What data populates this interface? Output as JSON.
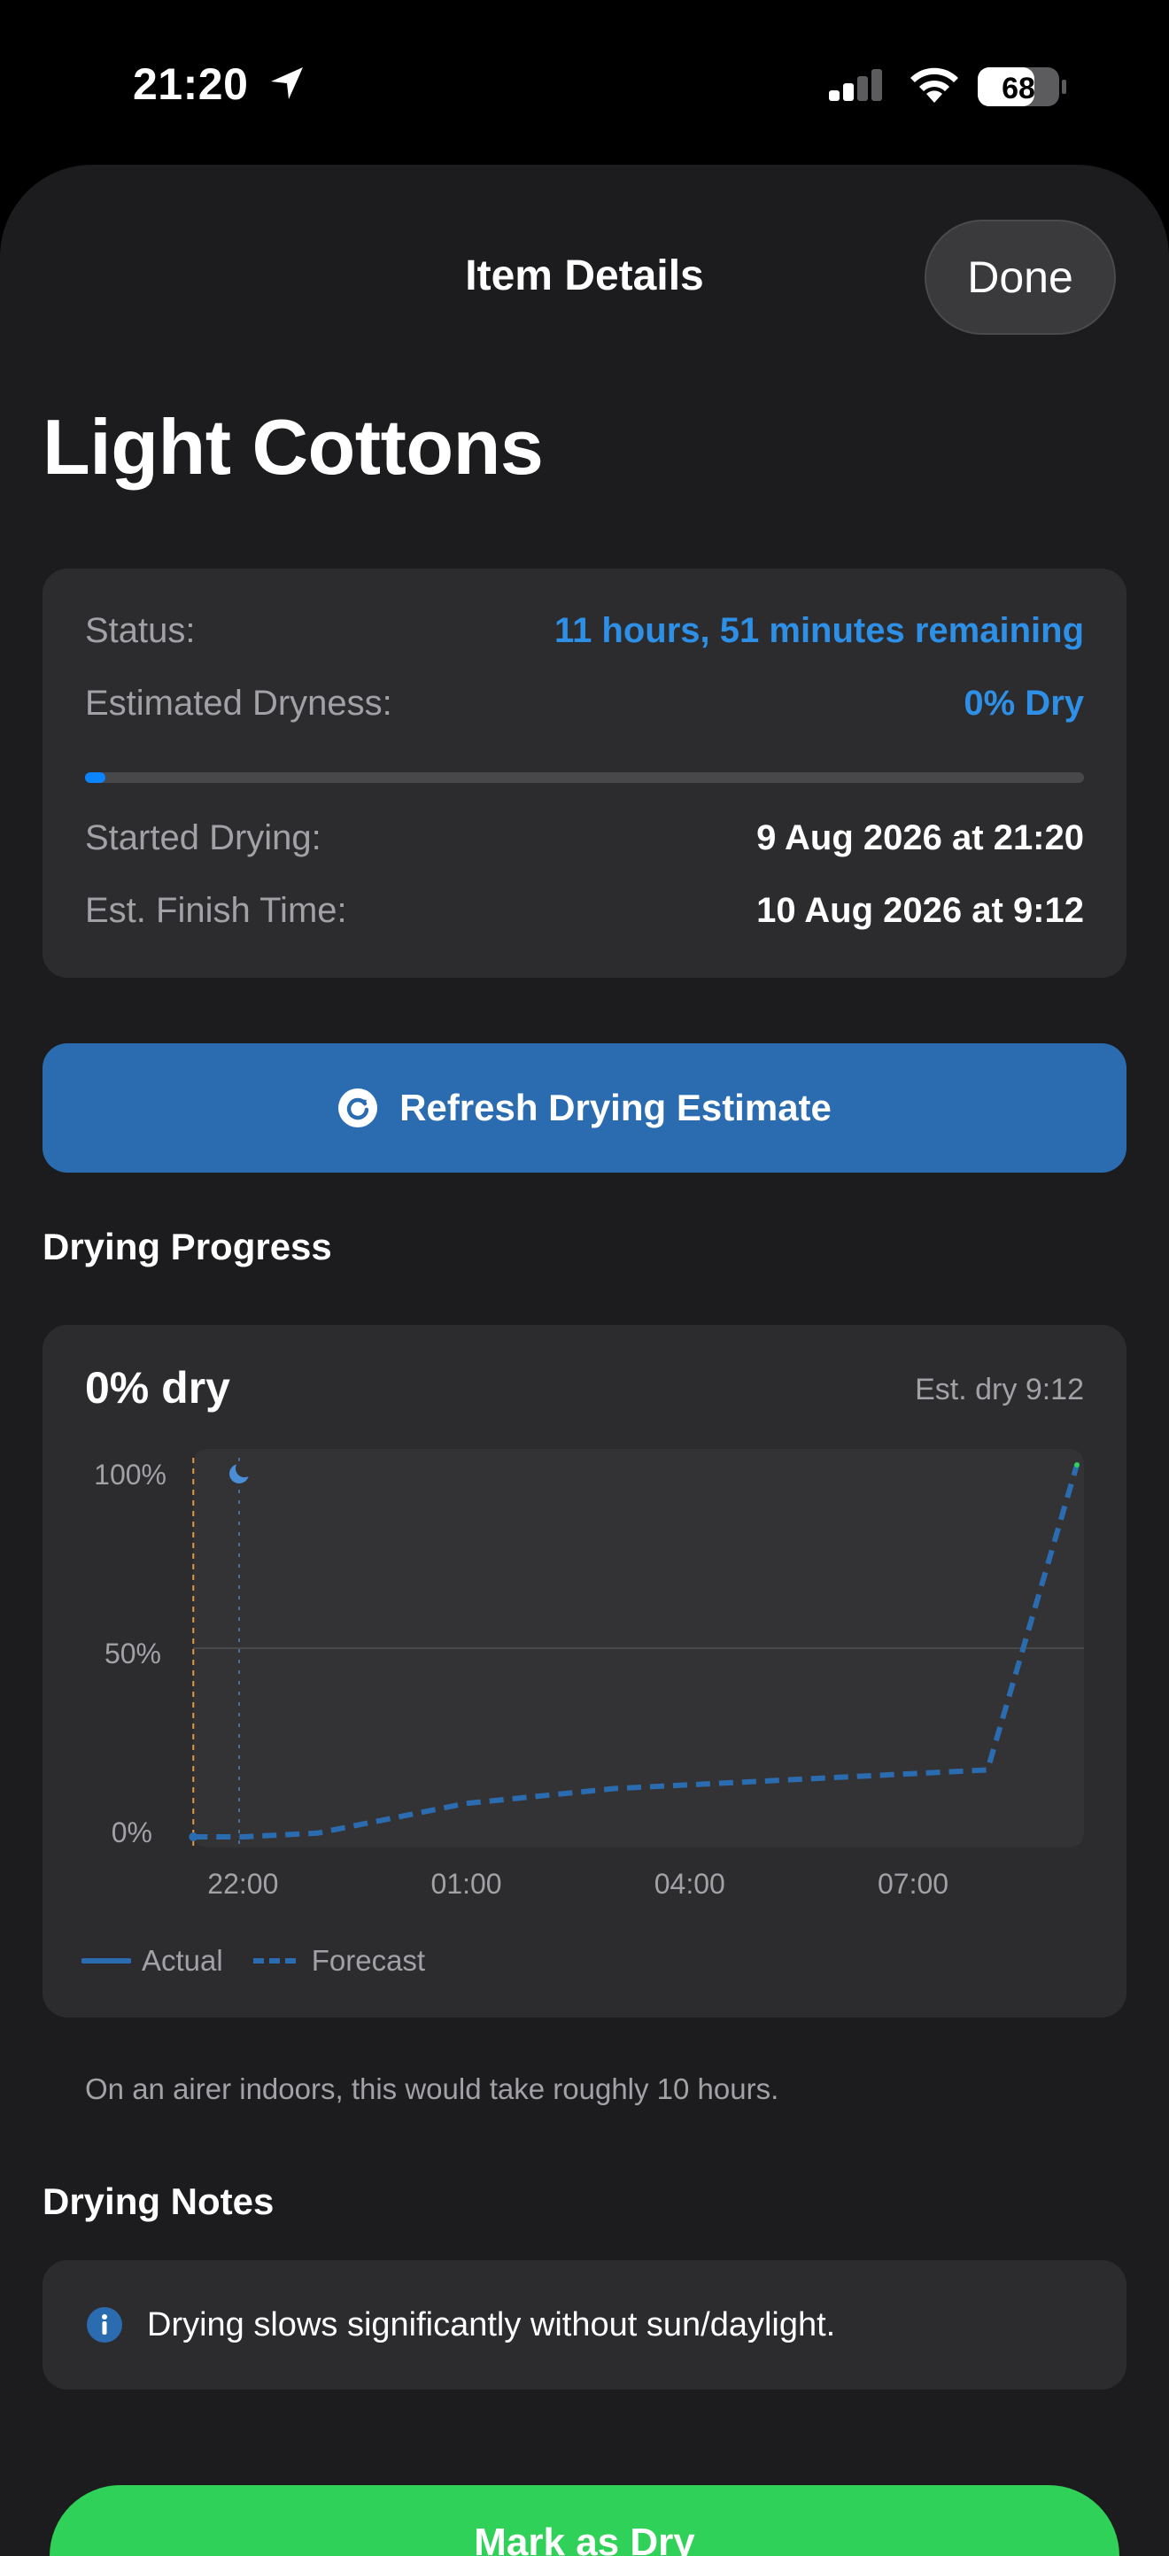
{
  "status_bar": {
    "time": "21:20",
    "battery": "68",
    "icons": [
      "location-arrow-icon",
      "cellular-signal-icon",
      "wifi-icon",
      "battery-icon"
    ]
  },
  "header": {
    "title": "Item Details",
    "done_label": "Done"
  },
  "item": {
    "name": "Light Cottons"
  },
  "status_card": {
    "status_label": "Status:",
    "status_value": "11 hours, 51 minutes remaining",
    "dryness_label": "Estimated Dryness:",
    "dryness_value": "0% Dry",
    "progress_fraction": 0.01,
    "started_label": "Started Drying:",
    "started_value": "9 Aug 2026 at 21:20",
    "finish_label": "Est. Finish Time:",
    "finish_value": "10 Aug 2026 at 9:12"
  },
  "refresh_button": {
    "label": "Refresh Drying Estimate",
    "icon": "refresh-icon"
  },
  "progress_section": {
    "heading": "Drying Progress",
    "chart_title": "0% dry",
    "chart_subtitle": "Est. dry 9:12",
    "legend": {
      "actual": "Actual",
      "forecast": "Forecast"
    },
    "footnote": "On an airer indoors, this would take roughly 10 hours."
  },
  "chart_data": {
    "type": "line",
    "title": "0% dry",
    "subtitle": "Est. dry 9:12",
    "xlabel": "",
    "ylabel": "",
    "x_ticks": [
      "22:00",
      "01:00",
      "04:00",
      "07:00"
    ],
    "y_ticks": [
      "100%",
      "50%",
      "0%"
    ],
    "x_range_hours": [
      21.33,
      33.2
    ],
    "ylim": [
      0,
      100
    ],
    "grid": "horizontal at 50%",
    "legend_position": "bottom-left",
    "markers": {
      "start_time": "21:20",
      "night_marker": "moon-icon"
    },
    "series": [
      {
        "name": "Actual",
        "style": "solid",
        "color": "#2b6cb0",
        "points": [
          {
            "x": "21:20",
            "y": 0
          }
        ]
      },
      {
        "name": "Forecast",
        "style": "dashed",
        "color": "#2b6cb0",
        "points": [
          {
            "x": "21:20",
            "y": 0
          },
          {
            "x": "22:00",
            "y": 0
          },
          {
            "x": "23:00",
            "y": 1
          },
          {
            "x": "00:00",
            "y": 5
          },
          {
            "x": "01:00",
            "y": 9
          },
          {
            "x": "02:00",
            "y": 11
          },
          {
            "x": "03:00",
            "y": 13
          },
          {
            "x": "04:00",
            "y": 14
          },
          {
            "x": "05:00",
            "y": 15
          },
          {
            "x": "06:00",
            "y": 16
          },
          {
            "x": "07:00",
            "y": 17
          },
          {
            "x": "08:00",
            "y": 18
          },
          {
            "x": "09:12",
            "y": 100
          }
        ]
      }
    ]
  },
  "notes_section": {
    "heading": "Drying Notes",
    "note": "Drying slows significantly without sun/daylight."
  },
  "bottom_button": {
    "label": "Mark as Dry"
  }
}
